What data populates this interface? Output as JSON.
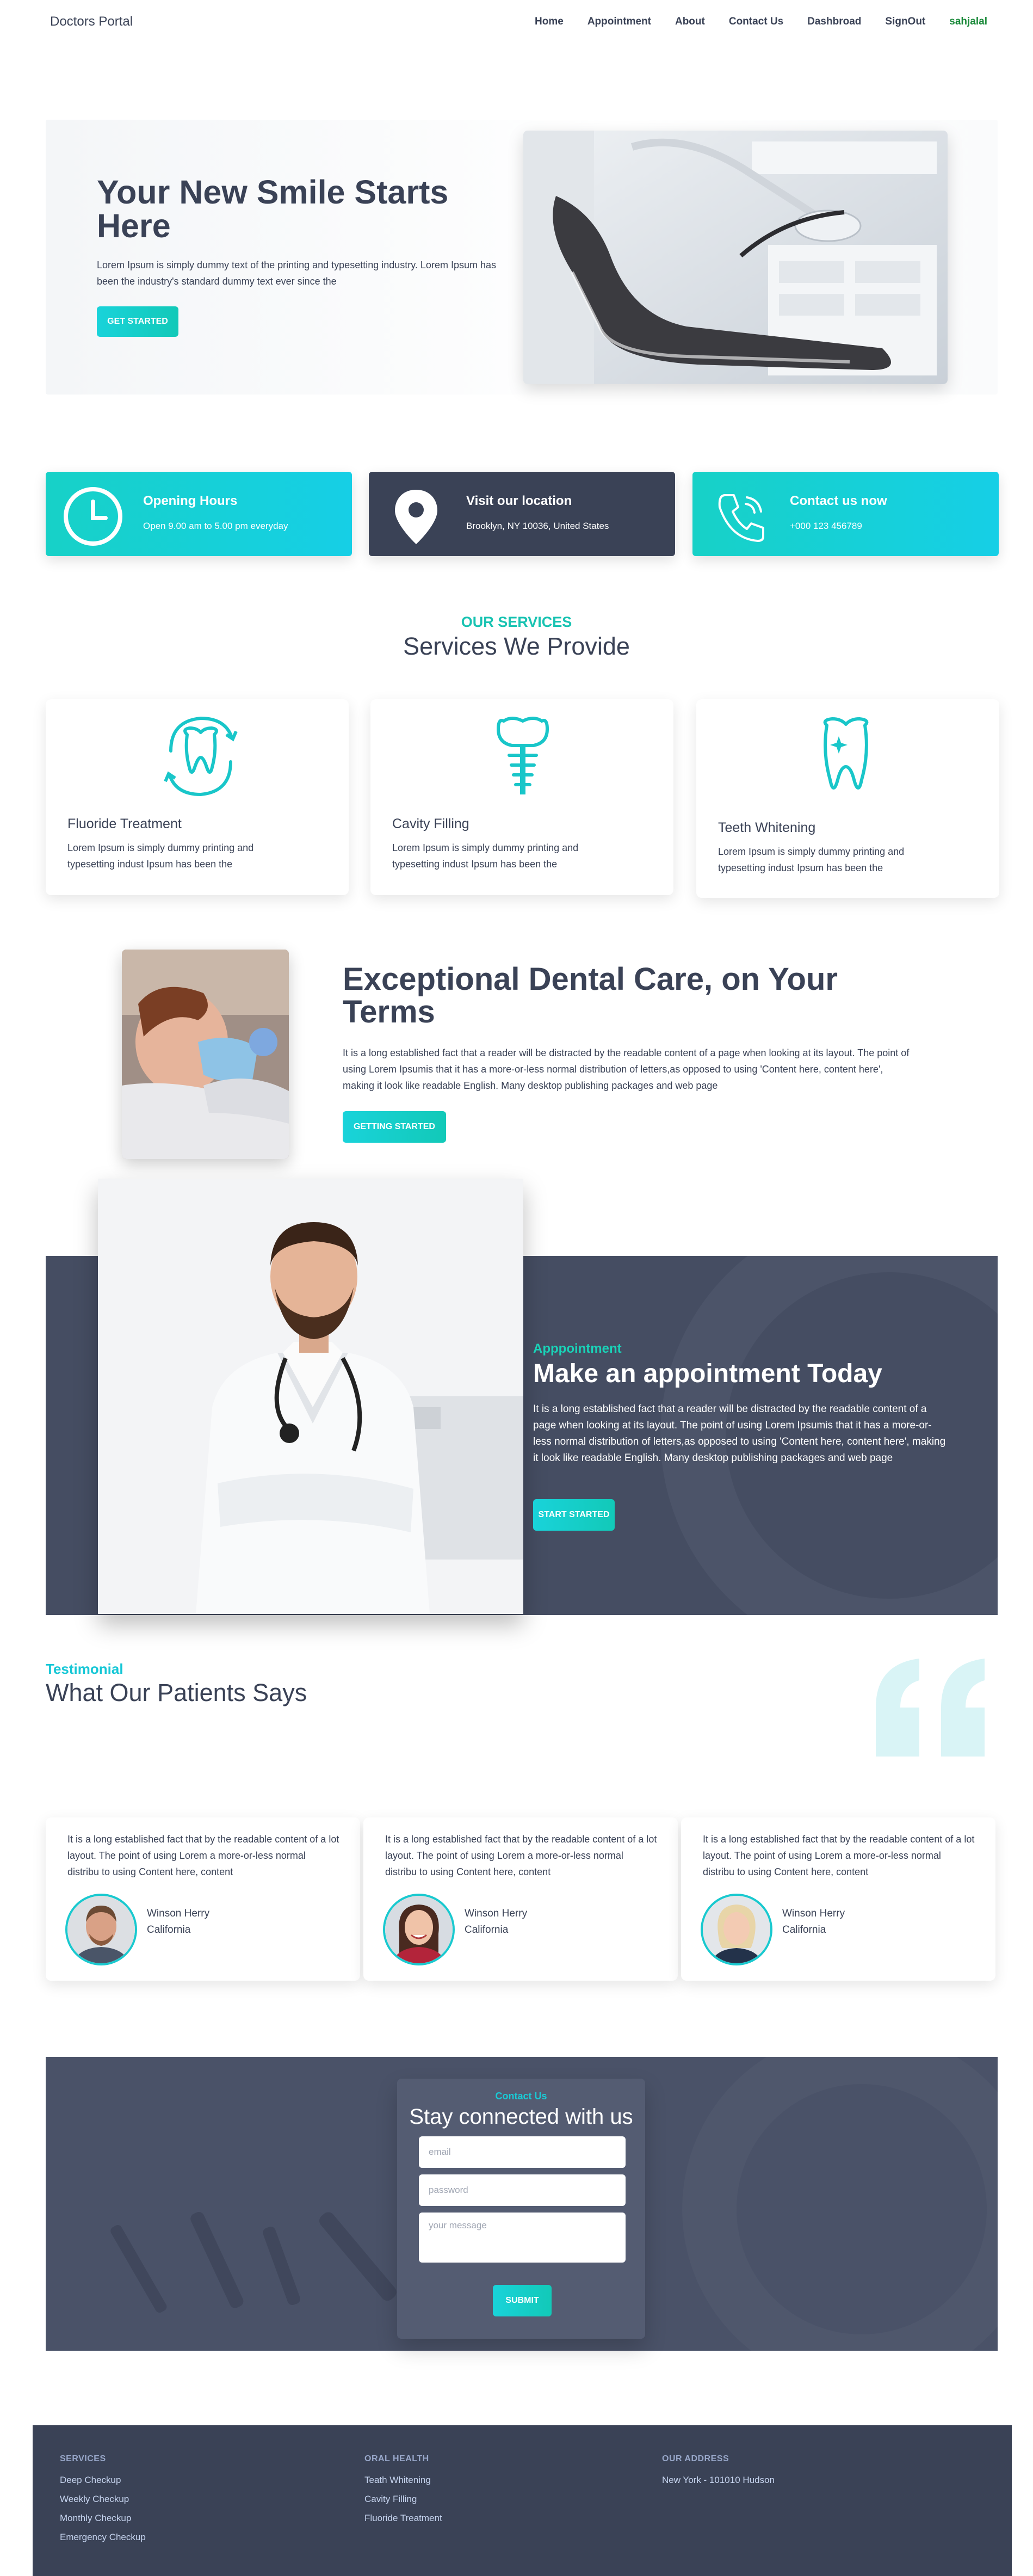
{
  "nav": {
    "brand": "Doctors Portal",
    "links": [
      "Home",
      "Appointment",
      "About",
      "Contact Us",
      "Dashbroad",
      "SignOut"
    ],
    "user": "sahjalal"
  },
  "hero": {
    "title": "Your New Smile Starts Here",
    "text": "Lorem Ipsum is simply dummy text of the printing and typesetting industry. Lorem Ipsum has been the industry's standard dummy text ever since the",
    "button": "GET STARTED"
  },
  "info": [
    {
      "title": "Opening Hours",
      "text": "Open 9.00 am to 5.00 pm everyday",
      "icon": "clock-icon"
    },
    {
      "title": "Visit our location",
      "text": "Brooklyn, NY 10036, United States",
      "icon": "map-pin-icon"
    },
    {
      "title": "Contact us now",
      "text": "+000 123 456789",
      "icon": "phone-icon"
    }
  ],
  "services": {
    "subtitle": "OUR SERVICES",
    "title": "Services We Provide",
    "items": [
      {
        "name": "Fluoride Treatment",
        "text": "Lorem Ipsum is simply dummy printing and typesetting indust Ipsum has been the",
        "icon": "tooth-refresh-icon"
      },
      {
        "name": "Cavity Filling",
        "text": "Lorem Ipsum is simply dummy printing and typesetting indust Ipsum has been the",
        "icon": "tooth-implant-icon"
      },
      {
        "name": "Teeth Whitening",
        "text": "Lorem Ipsum is simply dummy printing and typesetting indust Ipsum has been the",
        "icon": "tooth-sparkle-icon"
      }
    ]
  },
  "exceptional": {
    "title": "Exceptional Dental Care, on Your Terms",
    "text": "It is a long established fact that a reader will be distracted by the readable content of a page when looking at its layout. The point of using Lorem Ipsumis that it has a more-or-less normal distribution of letters,as opposed to using 'Content here, content here', making it look like readable English. Many desktop publishing packages and web page",
    "button": "GETTING STARTED"
  },
  "appointment": {
    "subtitle": "Apppointment",
    "title": "Make an appointment Today",
    "text": "It is a long established fact that a reader will be distracted by the readable content of a page when looking at its layout. The point of using Lorem Ipsumis that it has a more-or-less normal distribution of letters,as opposed to using 'Content here, content here', making it look like readable English. Many desktop publishing packages and web page",
    "button": "START STARTED"
  },
  "testimonial": {
    "subtitle": "Testimonial",
    "title": "What Our Patients Says",
    "items": [
      {
        "text": "It is a long established fact that by the readable content of a lot layout. The point of using Lorem a more-or-less normal distribu to using Content here, content",
        "name": "Winson Herry",
        "location": "California"
      },
      {
        "text": "It is a long established fact that by the readable content of a lot layout. The point of using Lorem a more-or-less normal distribu to using Content here, content",
        "name": "Winson Herry",
        "location": "California"
      },
      {
        "text": "It is a long established fact that by the readable content of a lot layout. The point of using Lorem a more-or-less normal distribu to using Content here, content",
        "name": "Winson Herry",
        "location": "California"
      }
    ]
  },
  "contact": {
    "subtitle": "Contact Us",
    "title": "Stay connected with us",
    "email_placeholder": "email",
    "password_placeholder": "password",
    "message_placeholder": "your message",
    "button": "SUBMIT"
  },
  "footer": {
    "columns": [
      {
        "heading": "SERVICES",
        "links": [
          "Deep Checkup",
          "Weekly Checkup",
          "Monthly Checkup",
          "Emergency Checkup"
        ]
      },
      {
        "heading": "ORAL HEALTH",
        "links": [
          "Teath Whitening",
          "Cavity Filling",
          "Fluoride Treatment"
        ]
      },
      {
        "heading": "OUR ADDRESS",
        "links": [
          "New York - 101010 Hudson"
        ]
      }
    ]
  },
  "colors": {
    "accent": "#19d3da",
    "accent_green": "#12c9b8",
    "dark": "#3a4256",
    "user": "#1a8a3a"
  }
}
